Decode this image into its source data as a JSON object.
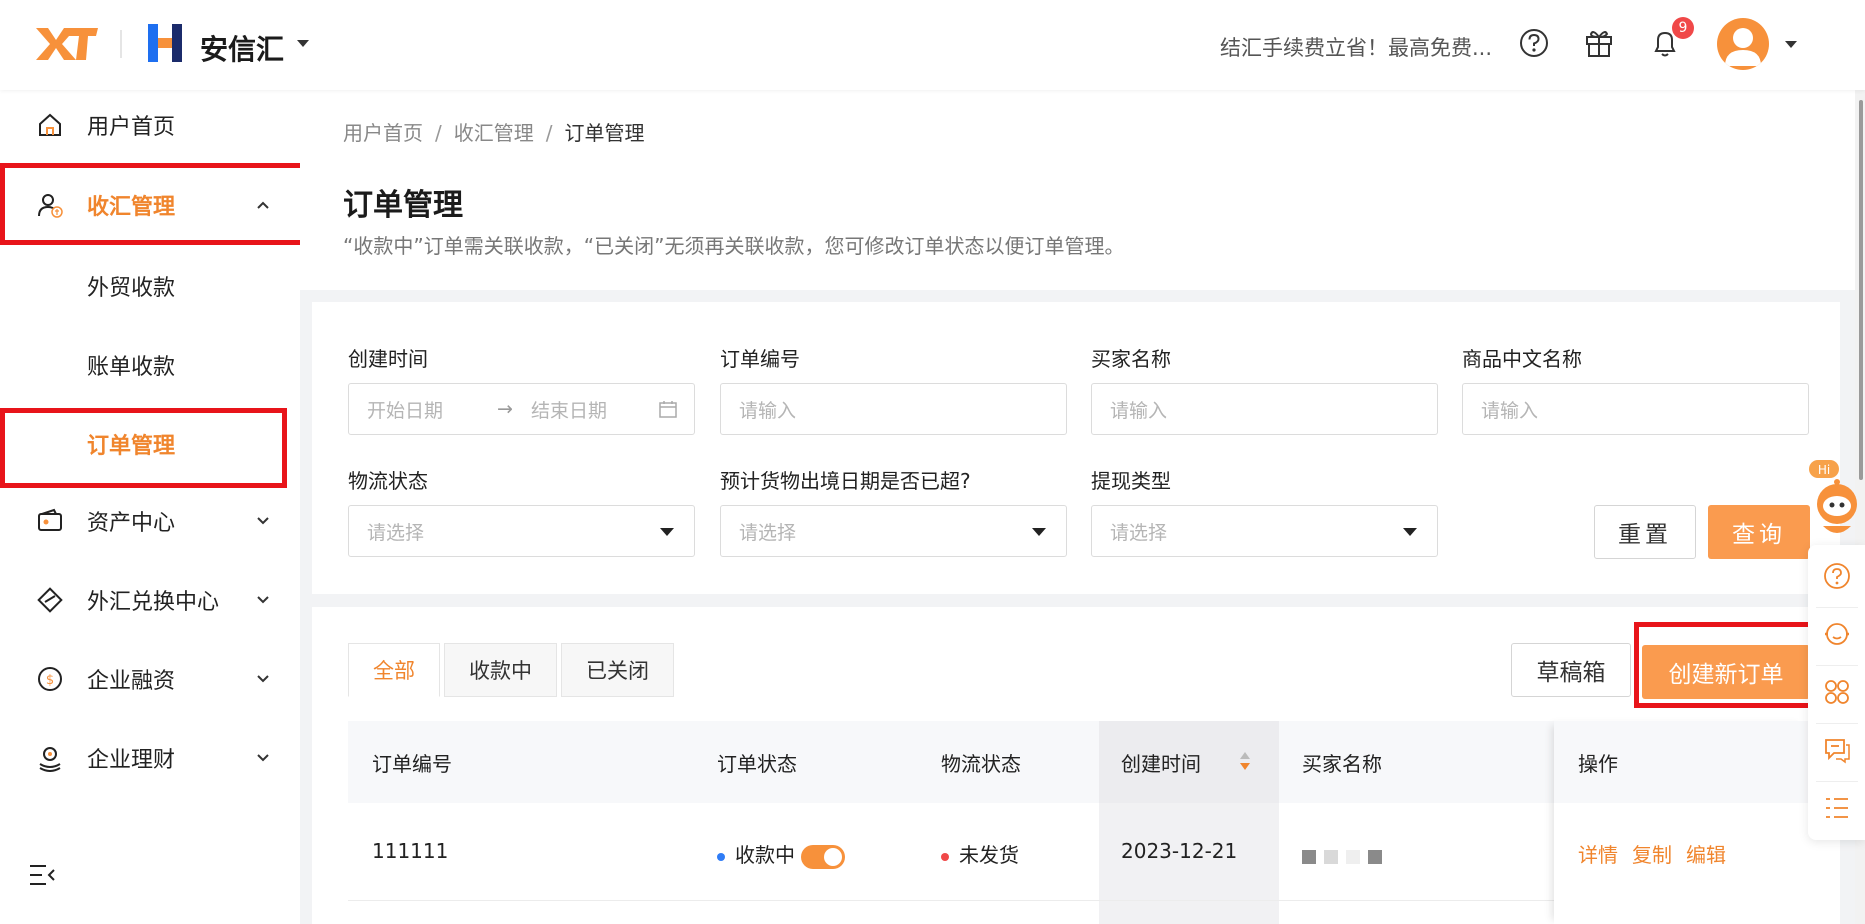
{
  "header": {
    "brand_name": "安信汇",
    "promo_text": "结汇手续费立省！最高免费...",
    "notification_count": "9"
  },
  "sidebar": {
    "items": [
      {
        "label": "用户首页"
      },
      {
        "label": "收汇管理"
      },
      {
        "label": "资产中心"
      },
      {
        "label": "外汇兑换中心"
      },
      {
        "label": "企业融资"
      },
      {
        "label": "企业理财"
      }
    ],
    "sub_items": [
      {
        "label": "外贸收款"
      },
      {
        "label": "账单收款"
      },
      {
        "label": "订单管理"
      }
    ]
  },
  "breadcrumb": {
    "items": [
      "用户首页",
      "收汇管理",
      "订单管理"
    ],
    "separator": "/"
  },
  "page": {
    "title": "订单管理",
    "description": "“收款中”订单需关联收款，“已关闭”无须再关联收款，您可修改订单状态以便订单管理。"
  },
  "filters": {
    "created_time_label": "创建时间",
    "start_date_placeholder": "开始日期",
    "date_arrow": "→",
    "end_date_placeholder": "结束日期",
    "order_no_label": "订单编号",
    "order_no_placeholder": "请输入",
    "buyer_label": "买家名称",
    "buyer_placeholder": "请输入",
    "product_label": "商品中文名称",
    "product_placeholder": "请输入",
    "logistics_label": "物流状态",
    "logistics_placeholder": "请选择",
    "overdue_label": "预计货物出境日期是否已超?",
    "overdue_placeholder": "请选择",
    "withdraw_label": "提现类型",
    "withdraw_placeholder": "请选择",
    "reset_label": "重置",
    "query_label": "查询"
  },
  "tabs": [
    {
      "label": "全部",
      "active": true
    },
    {
      "label": "收款中",
      "active": false
    },
    {
      "label": "已关闭",
      "active": false
    }
  ],
  "actions": {
    "drafts_label": "草稿箱",
    "create_label": "创建新订单"
  },
  "table": {
    "columns": [
      "订单编号",
      "订单状态",
      "物流状态",
      "创建时间",
      "买家名称",
      "操作"
    ],
    "rows": [
      {
        "order_no": "111111",
        "order_status": "收款中",
        "logistics_status": "未发货",
        "created_time": "2023-12-21",
        "ops": [
          "详情",
          "复制",
          "编辑"
        ]
      }
    ]
  },
  "mascot": {
    "greeting": "Hi"
  },
  "colors": {
    "accent": "#f0852d",
    "primary_button": "#fa9b4f",
    "highlight_box": "#e8141a",
    "status_blue": "#2f7cf6",
    "status_red": "#f04848"
  }
}
